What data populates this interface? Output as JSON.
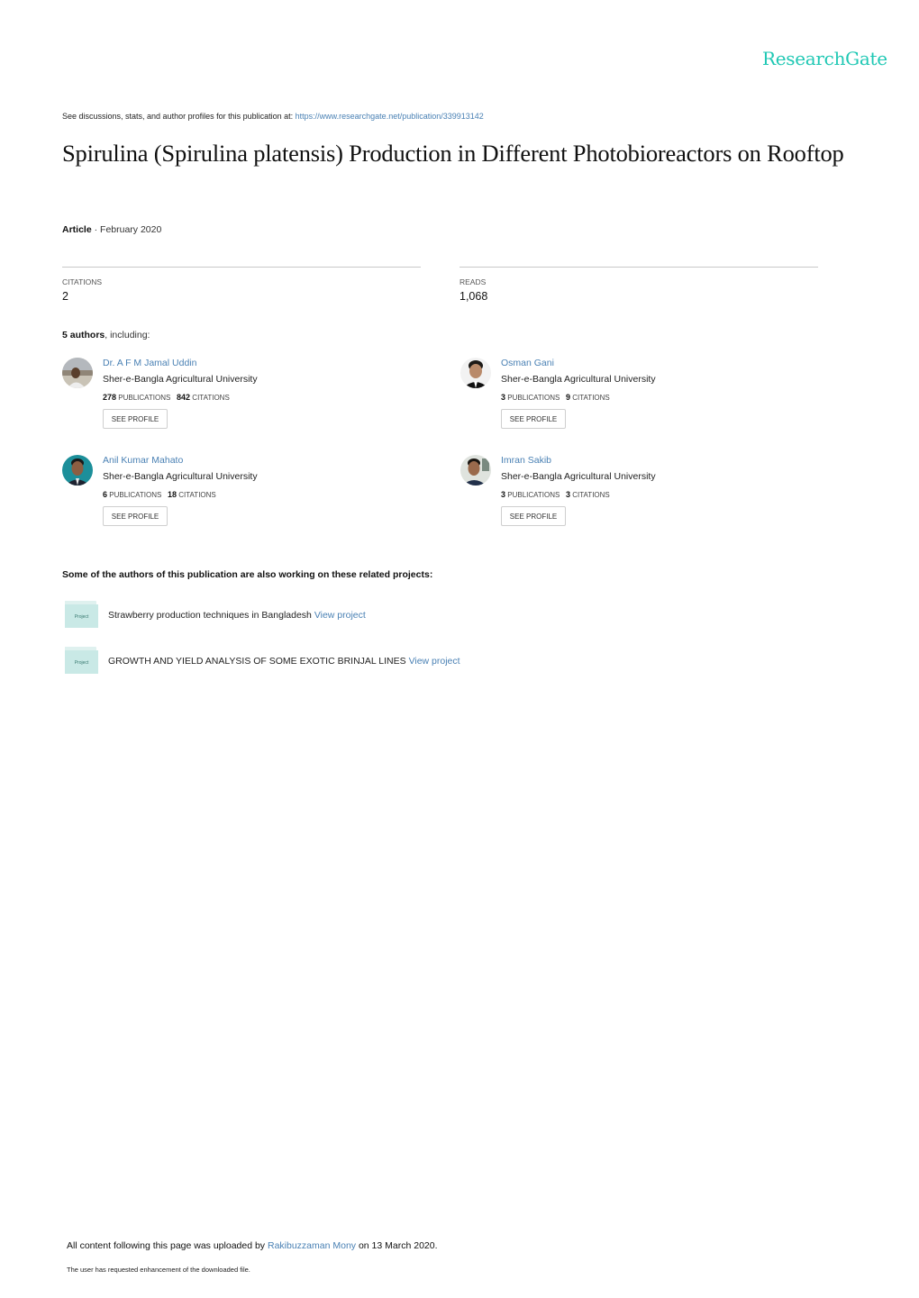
{
  "brand": {
    "name": "ResearchGate",
    "color": "#1fc8b4"
  },
  "header": {
    "see_discussions_text": "See discussions, stats, and author profiles for this publication at: ",
    "publication_url": "https://www.researchgate.net/publication/339913142"
  },
  "publication": {
    "title": "Spirulina (Spirulina platensis) Production in Different Photobioreactors on Rooftop",
    "type": "Article",
    "separator": " · ",
    "date": "February 2020"
  },
  "stats": {
    "citations_label": "CITATIONS",
    "citations_value": "2",
    "reads_label": "READS",
    "reads_value": "1,068"
  },
  "authors_section": {
    "count_text": "5 authors",
    "suffix": ", including:",
    "see_profile_label": "SEE PROFILE",
    "publications_label": "PUBLICATIONS",
    "citations_label": "CITATIONS",
    "authors": [
      {
        "name": "Dr. A F M Jamal Uddin",
        "institution": "Sher-e-Bangla Agricultural University",
        "publications": "278",
        "citations": "842"
      },
      {
        "name": "Osman Gani",
        "institution": "Sher-e-Bangla Agricultural University",
        "publications": "3",
        "citations": "9"
      },
      {
        "name": "Anil Kumar Mahato",
        "institution": "Sher-e-Bangla Agricultural University",
        "publications": "6",
        "citations": "18"
      },
      {
        "name": "Imran Sakib",
        "institution": "Sher-e-Bangla Agricultural University",
        "publications": "3",
        "citations": "3"
      }
    ]
  },
  "related_projects": {
    "heading": "Some of the authors of this publication are also working on these related projects:",
    "folder_label": "Project",
    "view_label": "View project",
    "projects": [
      {
        "title": "Strawberry production techniques in Bangladesh"
      },
      {
        "title": "GROWTH AND YIELD ANALYSIS OF SOME EXOTIC BRINJAL LINES"
      }
    ]
  },
  "footer": {
    "upload_prefix": "All content following this page was uploaded by ",
    "uploader": "Rakibuzzaman Mony",
    "upload_suffix": " on 13 March 2020.",
    "enhancement_note": "The user has requested enhancement of the downloaded file."
  }
}
